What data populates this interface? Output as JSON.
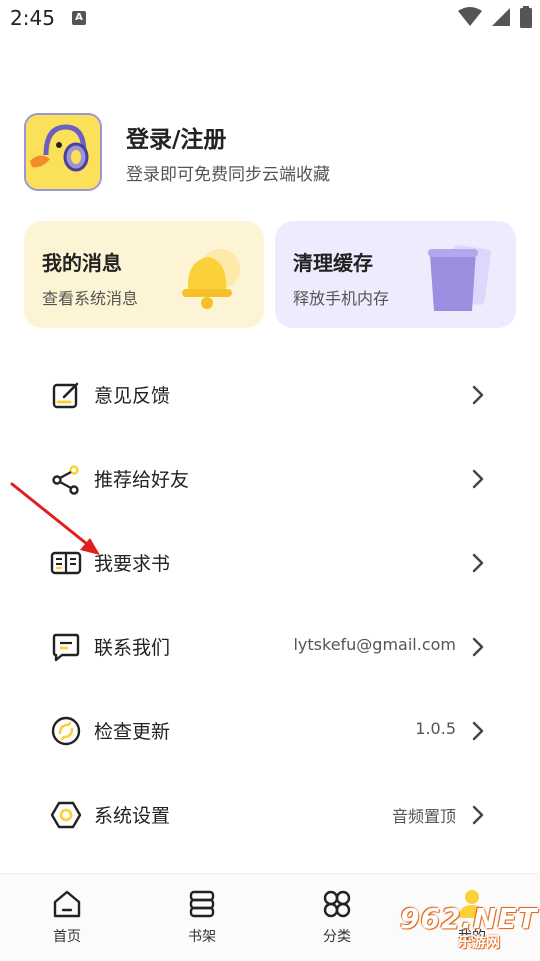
{
  "status_bar": {
    "time": "2:45",
    "notif_letter": "A"
  },
  "profile": {
    "title": "登录/注册",
    "subtitle": "登录即可免费同步云端收藏"
  },
  "cards": {
    "messages": {
      "title": "我的消息",
      "subtitle": "查看系统消息"
    },
    "cache": {
      "title": "清理缓存",
      "subtitle": "释放手机内存"
    }
  },
  "menu": {
    "feedback": {
      "label": "意见反馈",
      "value": ""
    },
    "recommend": {
      "label": "推荐给好友",
      "value": ""
    },
    "request_book": {
      "label": "我要求书",
      "value": ""
    },
    "contact": {
      "label": "联系我们",
      "value": "lytskefu@gmail.com"
    },
    "update": {
      "label": "检查更新",
      "value": "1.0.5"
    },
    "settings": {
      "label": "系统设置",
      "value": "音频置顶"
    }
  },
  "bottom_nav": {
    "home": "首页",
    "bookshelf": "书架",
    "category": "分类",
    "mine": "我的"
  },
  "watermark": {
    "brand": "962.NET",
    "sub": "乐游网"
  },
  "colors": {
    "accent_yellow": "#fbd13a",
    "accent_purple": "#9a8fe0",
    "card_yellow_bg": "#fdf4d5",
    "card_purple_bg": "#eeebff",
    "annotation_red": "#e02020"
  }
}
